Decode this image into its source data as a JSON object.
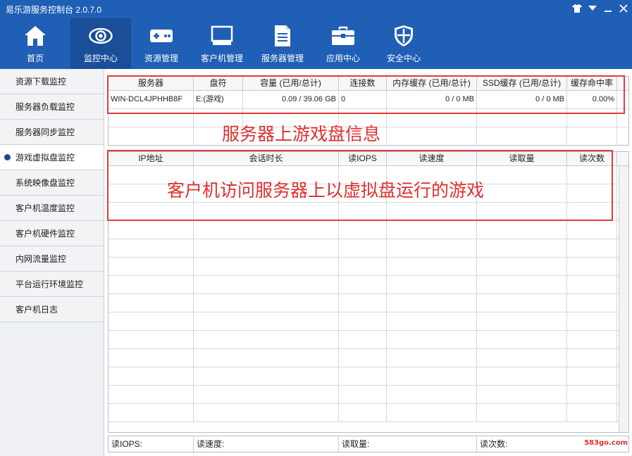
{
  "window": {
    "title": "易乐游服务控制台 2.0.7.0"
  },
  "toolbar": {
    "items": [
      {
        "label": "首页",
        "icon": "home-icon"
      },
      {
        "label": "监控中心",
        "icon": "eye-icon"
      },
      {
        "label": "资源管理",
        "icon": "gamepad-icon"
      },
      {
        "label": "客户机管理",
        "icon": "monitor-icon"
      },
      {
        "label": "服务器管理",
        "icon": "server-icon"
      },
      {
        "label": "应用中心",
        "icon": "toolbox-icon"
      },
      {
        "label": "安全中心",
        "icon": "shield-icon"
      }
    ],
    "active_index": 1
  },
  "sidebar": {
    "items": [
      {
        "label": "资源下载监控"
      },
      {
        "label": "服务器负载监控"
      },
      {
        "label": "服务器同步监控"
      },
      {
        "label": "游戏虚拟盘监控"
      },
      {
        "label": "系统映像盘监控"
      },
      {
        "label": "客户机温度监控"
      },
      {
        "label": "客户机硬件监控"
      },
      {
        "label": "内网流量监控"
      },
      {
        "label": "平台运行环境监控"
      },
      {
        "label": "客户机日志"
      }
    ],
    "active_index": 3
  },
  "disk_table": {
    "headers": [
      "服务器",
      "盘符",
      "容量 (已用/总计)",
      "连接数",
      "内存缓存 (已用/总计)",
      "SSD缓存 (已用/总计)",
      "缓存命中率"
    ],
    "rows": [
      [
        "WIN-DCL4JPHHB8F",
        "E:(游戏)",
        "0.09 / 39.06 GB",
        "0",
        "0 / 0 MB",
        "0 / 0 MB",
        "0.00%"
      ]
    ]
  },
  "session_table": {
    "headers": [
      "IP地址",
      "会话时长",
      "读IOPS",
      "读速度",
      "读取量",
      "读次数"
    ]
  },
  "annotations": {
    "top": "服务器上游戏盘信息",
    "bottom": "客户机访问服务器上以虚拟盘运行的游戏"
  },
  "statusbar": {
    "read_iops": "读IOPS:",
    "read_speed": "读速度:",
    "read_amount": "读取量:",
    "read_count": "读次数:"
  },
  "watermark": {
    "text": "583go.com"
  },
  "colors": {
    "titlebar": "#1f5fb5",
    "active_nav": "#1a4e98",
    "annotation_red": "#e0302f"
  }
}
